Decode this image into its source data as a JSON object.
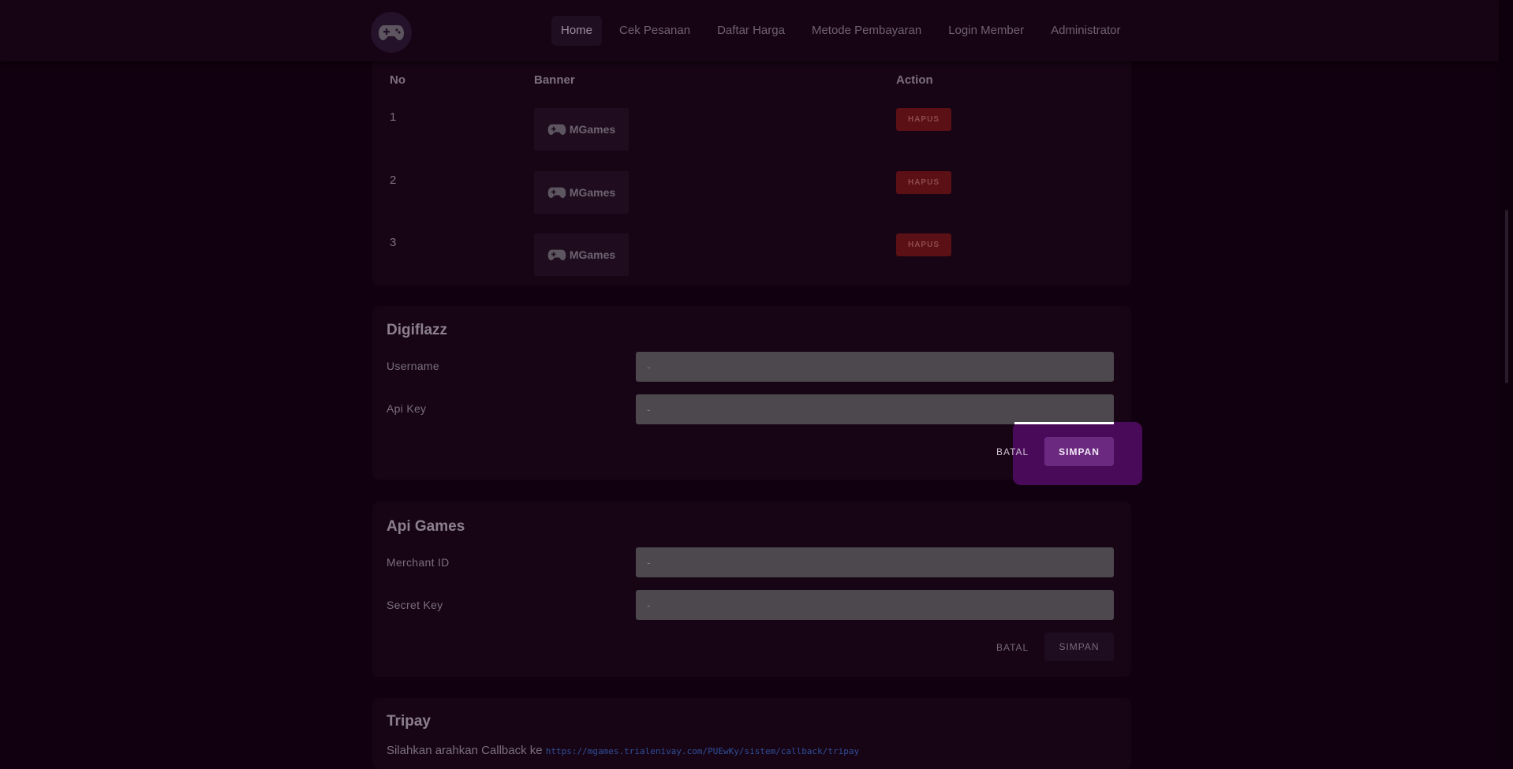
{
  "nav": {
    "logo_icon": "gamepad-icon",
    "links": [
      "Home",
      "Cek Pesanan",
      "Daftar Harga",
      "Metode Pembayaran",
      "Login Member",
      "Administrator"
    ],
    "active": "Home"
  },
  "banner_table": {
    "headers": {
      "no": "No",
      "banner": "Banner",
      "action": "Action"
    },
    "rows": [
      {
        "no": "1",
        "banner": "MGames",
        "action": "HAPUS"
      },
      {
        "no": "2",
        "banner": "MGames",
        "action": "HAPUS"
      },
      {
        "no": "3",
        "banner": "MGames",
        "action": "HAPUS"
      }
    ]
  },
  "digiflazz": {
    "title": "Digiflazz",
    "username_label": "Username",
    "username_value": "-",
    "apikey_label": "Api Key",
    "apikey_value": "-",
    "cancel": "BATAL",
    "save": "SIMPAN"
  },
  "apigames": {
    "title": "Api Games",
    "merchant_label": "Merchant ID",
    "merchant_value": "-",
    "secret_label": "Secret Key",
    "secret_value": "-",
    "cancel": "BATAL",
    "save": "SIMPAN"
  },
  "tripay": {
    "title": "Tripay",
    "callback_text": "Silahkan arahkan Callback ke ",
    "callback_url": "https://mgames.trialenivay.com/PUEwKy/sistem/callback/tripay"
  },
  "colors": {
    "accent": "#6b2a80",
    "danger": "#5a1015",
    "background": "#11000f"
  }
}
